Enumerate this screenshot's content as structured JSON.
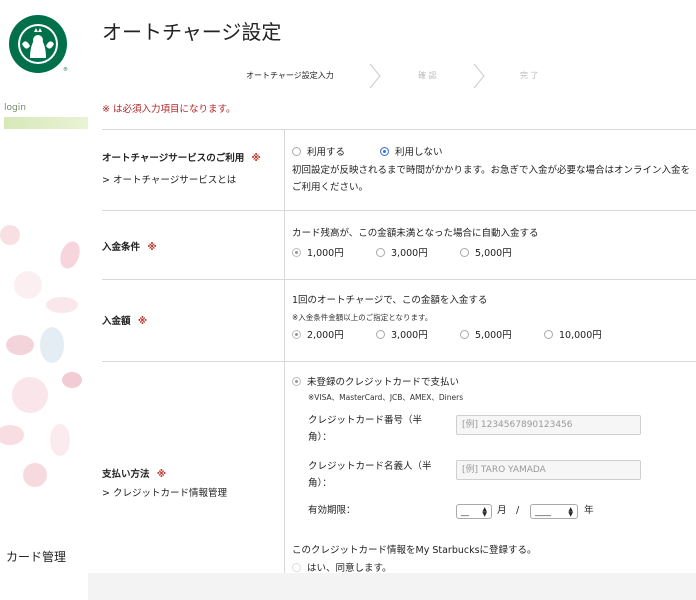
{
  "sidebar": {
    "login_label": "login",
    "card_management": "カード管理"
  },
  "page": {
    "title": "オートチャージ設定",
    "required_note": "※ は必須入力項目になります。"
  },
  "steps": [
    {
      "label": "オートチャージ設定入力",
      "active": true
    },
    {
      "label": "確 認",
      "active": false
    },
    {
      "label": "完 了",
      "active": false
    }
  ],
  "form": {
    "service": {
      "label": "オートチャージサービスのご利用",
      "required_mark": "※",
      "link": "オートチャージサービスとは",
      "options": [
        "利用する",
        "利用しない"
      ],
      "selected": "利用しない",
      "note": "初回設定が反映されるまで時間がかかります。お急ぎで入金が必要な場合はオンライン入金をご利用ください。"
    },
    "condition": {
      "label": "入金条件",
      "required_mark": "※",
      "desc": "カード残高が、この金額未満となった場合に自動入金する",
      "options": [
        "1,000円",
        "3,000円",
        "5,000円"
      ]
    },
    "amount": {
      "label": "入金額",
      "required_mark": "※",
      "desc": "1回のオートチャージで、この金額を入金する",
      "note": "※入金条件金額以上のご指定となります。",
      "options": [
        "2,000円",
        "3,000円",
        "5,000円",
        "10,000円"
      ]
    },
    "payment": {
      "label": "支払い方法",
      "required_mark": "※",
      "link": "クレジットカード情報管理",
      "option": "未登録のクレジットカードで支払い",
      "brands": "※VISA、MasterCard、JCB、AMEX、Diners",
      "card_number_label": "クレジットカード番号（半角）：",
      "card_number_placeholder": "[例] 1234567890123456",
      "card_name_label": "クレジットカード名義人（半角）：",
      "card_name_placeholder": "[例] TARO YAMADA",
      "expiry_label": "有効期限：",
      "month_value": "__",
      "month_unit": "月",
      "separator": "/",
      "year_value": "____",
      "year_unit": "年",
      "register_text": "このクレジットカード情報をMy Starbucksに登録する。",
      "agree_option": "はい、同意します。"
    }
  },
  "colors": {
    "brand_green": "#00704a",
    "required_red": "#b0272a",
    "radio_blue": "#3a73d8"
  }
}
